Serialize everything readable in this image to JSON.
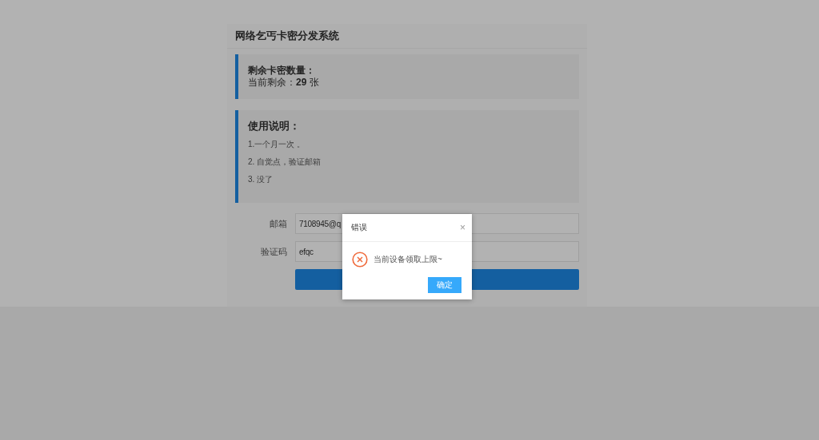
{
  "header": {
    "title": "网络乞丐卡密分发系统"
  },
  "stock_panel": {
    "heading": "剩余卡密数量：",
    "text": "当前剩余：**29** 张"
  },
  "instructions": {
    "heading": "使用说明：",
    "items": [
      "1.一个月一次 。",
      "2. 自觉点，验证邮箱",
      "3. 没了"
    ]
  },
  "form": {
    "fields": [
      {
        "label": "邮箱",
        "value": "7108945@q"
      },
      {
        "label": "验证码",
        "value": "efqc"
      }
    ]
  },
  "dialog": {
    "title": "错误",
    "close": "×",
    "kind": "error",
    "message": "当前设备领取上限~",
    "buttons": [
      "确定"
    ]
  }
}
